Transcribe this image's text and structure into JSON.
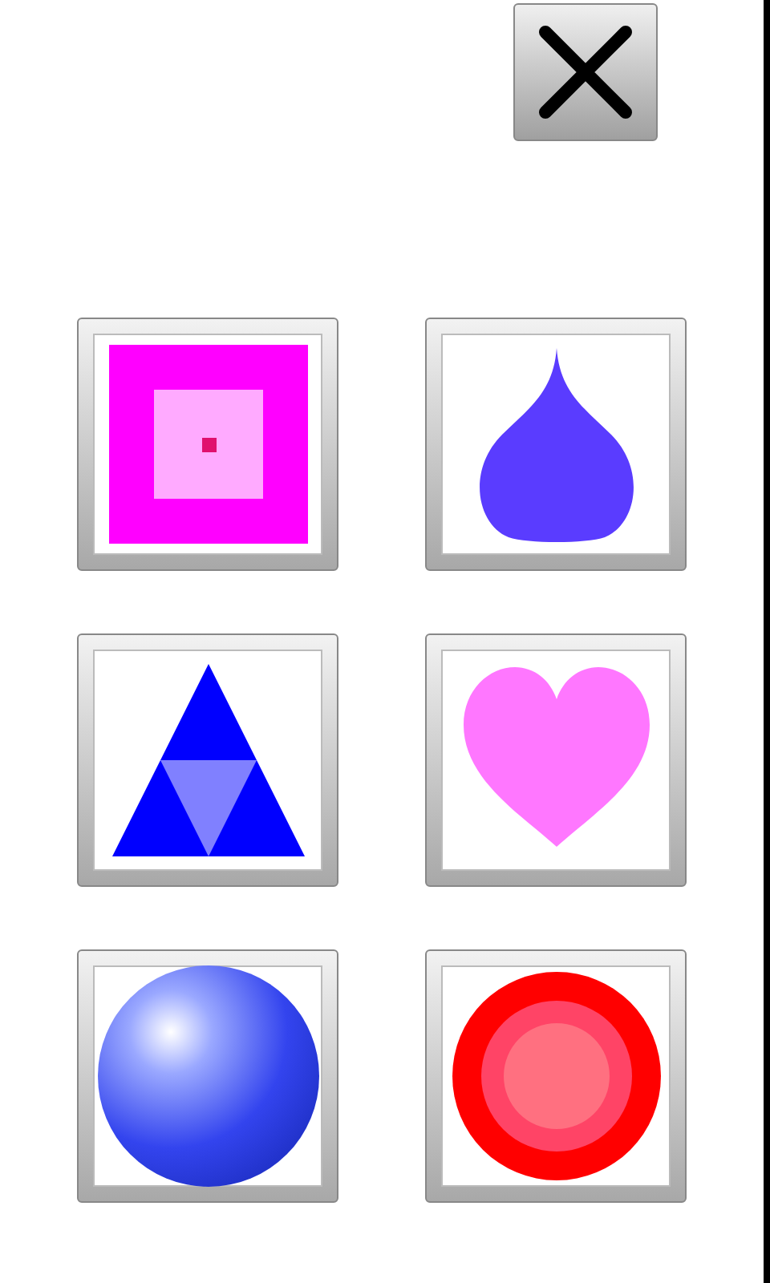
{
  "close_button": {
    "kind": "x"
  },
  "shape_buttons": [
    {
      "kind": "square"
    },
    {
      "kind": "drop"
    },
    {
      "kind": "triangle"
    },
    {
      "kind": "heart"
    },
    {
      "kind": "sphere"
    },
    {
      "kind": "ring"
    }
  ]
}
